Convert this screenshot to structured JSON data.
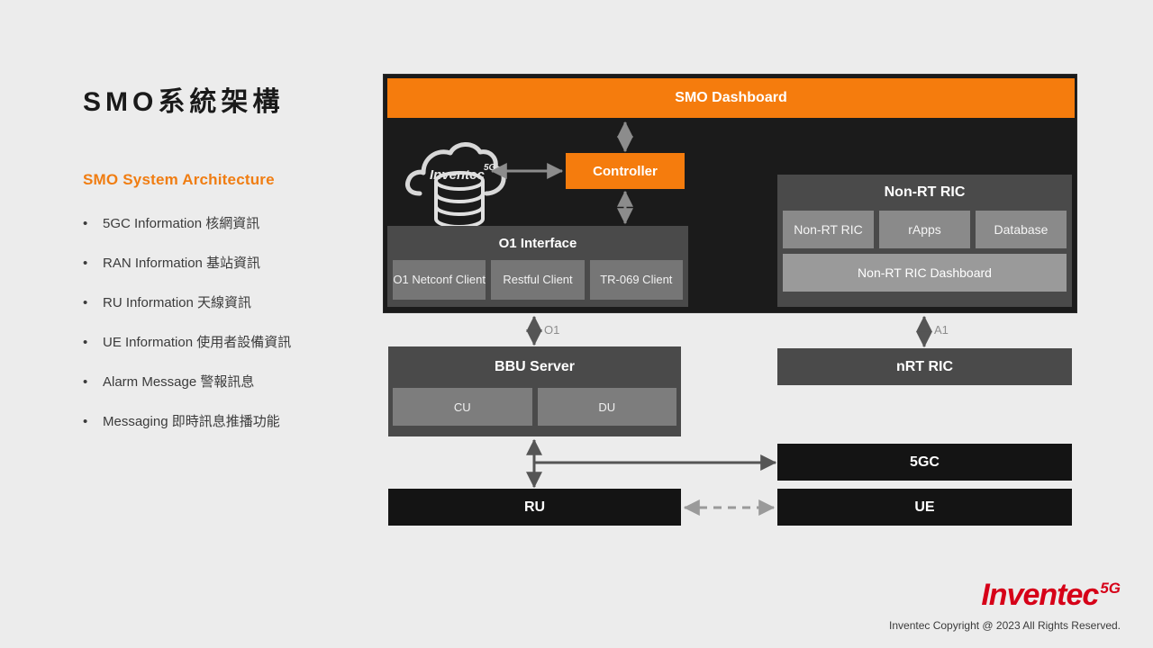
{
  "slide": {
    "title": "SMO系統架構",
    "subtitle": "SMO System Architecture",
    "bullets": [
      {
        "marker": "•",
        "text": "5GC Information 核網資訊"
      },
      {
        "marker": "•",
        "text": "RAN Information 基站資訊"
      },
      {
        "marker": "•",
        "text": "RU Information 天線資訊"
      },
      {
        "marker": "•",
        "text": "UE Information 使用者設備資訊"
      },
      {
        "marker": "•",
        "text": "Alarm Message 警報訊息"
      },
      {
        "marker": "•",
        "text": "Messaging 即時訊息推播功能"
      }
    ]
  },
  "diagram": {
    "smo_dashboard": "SMO Dashboard",
    "cloud_label": "Inventec",
    "cloud_superscript": "5G",
    "controller": "Controller",
    "o1_interface": {
      "title": "O1 Interface",
      "clients": [
        "O1 Netconf Client",
        "Restful Client",
        "TR-069 Client"
      ]
    },
    "non_rt_ric": {
      "title": "Non-RT RIC",
      "sub_boxes": [
        "Non-RT RIC",
        "rApps",
        "Database"
      ],
      "dashboard": "Non-RT RIC Dashboard"
    },
    "bbu_server": {
      "title": "BBU Server",
      "sub_boxes": [
        "CU",
        "DU"
      ]
    },
    "nrt_ric": "nRT RIC",
    "fivegc": "5GC",
    "ru": "RU",
    "ue": "UE",
    "connector_labels": {
      "o1": "O1",
      "a1": "A1"
    }
  },
  "footer": {
    "logo_text": "Inventec",
    "logo_superscript": "5G",
    "copyright": "Inventec Copyright @ 2023 All Rights Reserved."
  },
  "colors": {
    "accent_orange": "#f57c0d",
    "subtitle_orange": "#f07d12",
    "panel_dark": "#1b1b1b",
    "box_gray": "#4a4a4a",
    "sub_box_gray": "#8a8a8a",
    "black_box": "#141414",
    "logo_red": "#d60018",
    "background": "#ececec"
  }
}
